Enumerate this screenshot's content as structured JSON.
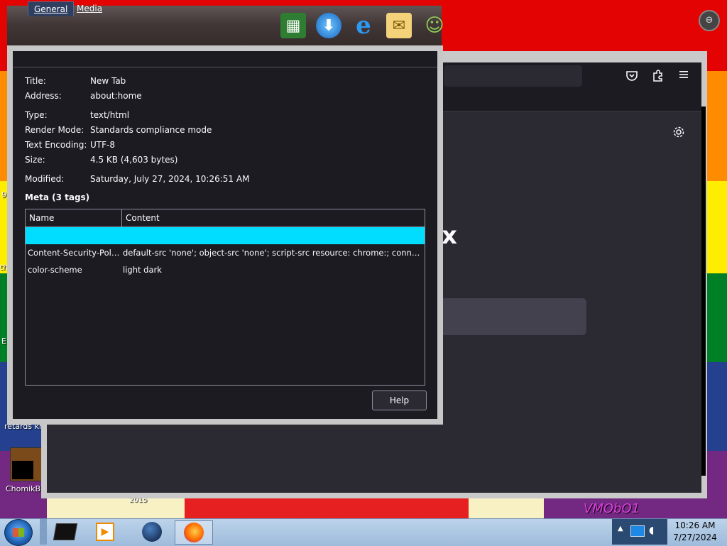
{
  "dialog": {
    "tabs": [
      {
        "label": "General",
        "active": true
      },
      {
        "label": "Media",
        "active": false
      }
    ],
    "fields": {
      "title": {
        "label": "Title:",
        "value": "New Tab"
      },
      "address": {
        "label": "Address:",
        "value": "about:home"
      },
      "type": {
        "label": "Type:",
        "value": "text/html"
      },
      "render_mode": {
        "label": "Render Mode:",
        "value": "Standards compliance mode"
      },
      "text_encoding": {
        "label": "Text Encoding:",
        "value": "UTF-8"
      },
      "size": {
        "label": "Size:",
        "value": "4.5 KB (4,603 bytes)"
      },
      "modified": {
        "label": "Modified:",
        "value": "Saturday, July 27, 2024, 10:26:51 AM"
      }
    },
    "meta_heading": "Meta (3 tags)",
    "meta_table": {
      "columns": [
        "Name",
        "Content"
      ],
      "rows": [
        {
          "name": "",
          "content": "",
          "selected": true
        },
        {
          "name": "Content-Security-Polic...",
          "content": "default-src 'none'; object-src 'none'; script-src resource: chrome:; connect-src ...",
          "selected": false
        },
        {
          "name": "color-scheme",
          "content": "light dark",
          "selected": false
        }
      ]
    },
    "help_label": "Help"
  },
  "desktop": {
    "icon_label_partial": "retards kn",
    "icon_label_2": "ChomikB",
    "year_text": "2015",
    "wallpaper_text": "VMObO1",
    "edge_letters": [
      "9",
      "th",
      "E"
    ]
  },
  "taskbar": {
    "items": [
      "start-button",
      "black-box-app",
      "media-player",
      "globe-app",
      "firefox"
    ],
    "clock_time": "10:26 AM",
    "clock_date": "7/27/2024"
  },
  "colors": {
    "selected_row": "#00ddff",
    "dialog_bg": "#1c1b22",
    "taskbar": "#9dbbdc"
  }
}
